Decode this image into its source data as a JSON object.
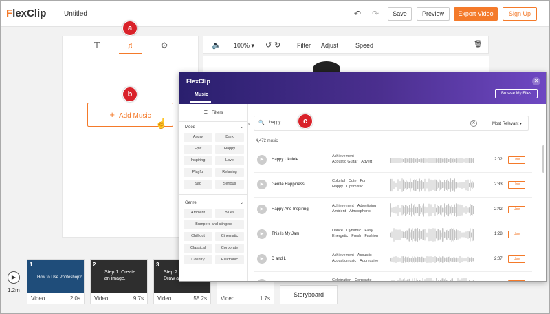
{
  "app": {
    "logo": "FlexClip",
    "doc_title": "Untitled"
  },
  "topbar": {
    "save": "Save",
    "preview": "Preview",
    "export": "Export Video",
    "signup": "Sign Up"
  },
  "left_panel": {
    "add_music": "Add Music"
  },
  "badges": {
    "a": "a",
    "b": "b",
    "c": "c"
  },
  "preview_bar": {
    "zoom": "100% ▾",
    "filter": "Filter",
    "adjust": "Adjust",
    "speed": "Speed"
  },
  "timeline": {
    "total": "1.2m",
    "clips": [
      {
        "num": "1",
        "caption": "How to Use Photoshop?",
        "type": "Video",
        "duration": "2.0s"
      },
      {
        "num": "2",
        "caption": "Step 1: Create an image.",
        "type": "Video",
        "duration": "9.7s"
      },
      {
        "num": "3",
        "caption": "Step 2: Draw an",
        "type": "Video",
        "duration": "58.2s"
      },
      {
        "num": "",
        "caption": "",
        "type": "Video",
        "duration": "1.7s"
      }
    ],
    "storyboard": "Storyboard"
  },
  "dialog": {
    "logo": "FlexClip",
    "tab": "Music",
    "browse": "Browse My Files",
    "filters": "Filters",
    "mood_title": "Mood",
    "mood": [
      "Angry",
      "Dark",
      "Epic",
      "Happy",
      "Inspiring",
      "Love",
      "Playful",
      "Relaxing",
      "Sad",
      "Serious"
    ],
    "genre_title": "Genre",
    "genre": [
      "Ambient",
      "Blues",
      "Bumpers and stingers",
      "Chill out",
      "Cinematic",
      "Classical",
      "Corporate",
      "Country",
      "Electronic"
    ],
    "search_value": "happy",
    "sort": "Most Relevant",
    "count": "4,472 music",
    "use_label": "Use",
    "tracks": [
      {
        "name": "Happy Ukulele",
        "tags_line1": [
          "Achievement"
        ],
        "tags_line2": [
          "Acoustic Guitar",
          "Advert"
        ],
        "duration": "2:02"
      },
      {
        "name": "Gentle Happiness",
        "tags_line1": [
          "Colorful",
          "Cute",
          "Fun"
        ],
        "tags_line2": [
          "Happy",
          "Optimistic"
        ],
        "duration": "2:33"
      },
      {
        "name": "Happy And Inspiring",
        "tags_line1": [
          "Achievement",
          "Advertising"
        ],
        "tags_line2": [
          "Ambient",
          "Atmospheric"
        ],
        "duration": "2:42"
      },
      {
        "name": "This Is My Jam",
        "tags_line1": [
          "Dance",
          "Dynamic",
          "Easy"
        ],
        "tags_line2": [
          "Energetic",
          "Fresh",
          "Fushion"
        ],
        "duration": "1:28"
      },
      {
        "name": "D and L",
        "tags_line1": [
          "Achievement",
          "Acoustic"
        ],
        "tags_line2": [
          "Acousticmusic",
          "Aggressive"
        ],
        "duration": "2:07"
      },
      {
        "name": "UP!",
        "tags_line1": [
          "Celebration",
          "Corporate"
        ],
        "tags_line2": [],
        "duration": "3:45"
      }
    ]
  },
  "colors": {
    "accent": "#f47a2a",
    "badge": "#d9222a",
    "dialog_header": "#4b2f8f"
  }
}
